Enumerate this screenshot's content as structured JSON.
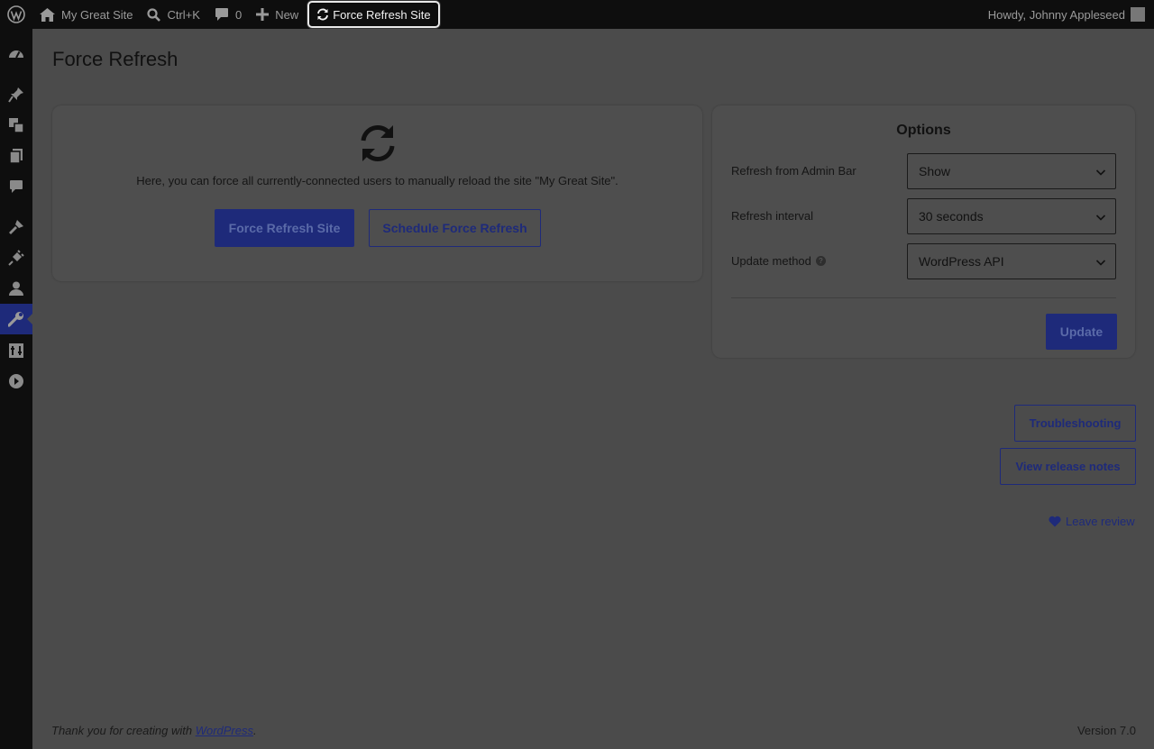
{
  "admin_bar": {
    "site_name": "My Great Site",
    "search_shortcut": "Ctrl+K",
    "comments_count": "0",
    "new_label": "New",
    "force_refresh_label": "Force Refresh Site",
    "greeting": "Howdy, Johnny Appleseed"
  },
  "page": {
    "title": "Force Refresh"
  },
  "main_card": {
    "intro_text": "Here, you can force all currently-connected users to manually reload the site \"My Great Site\".",
    "force_refresh_button": "Force Refresh Site",
    "schedule_button": "Schedule Force Refresh"
  },
  "options": {
    "title": "Options",
    "fields": [
      {
        "label": "Refresh from Admin Bar",
        "value": "Show"
      },
      {
        "label": "Refresh interval",
        "value": "30 seconds"
      },
      {
        "label": "Update method",
        "value": "WordPress API"
      }
    ],
    "update_button": "Update"
  },
  "side_links": {
    "troubleshooting": "Troubleshooting",
    "release_notes": "View release notes",
    "leave_review": "Leave review"
  },
  "footer": {
    "thanks_prefix": "Thank you for creating with ",
    "wordpress_link": "WordPress",
    "thanks_suffix": ".",
    "version": "Version 7.0"
  },
  "colors": {
    "accent": "#1e2a7a",
    "overlay_background": "#4b4b4b",
    "admin_bar": "#0e0e0e"
  }
}
